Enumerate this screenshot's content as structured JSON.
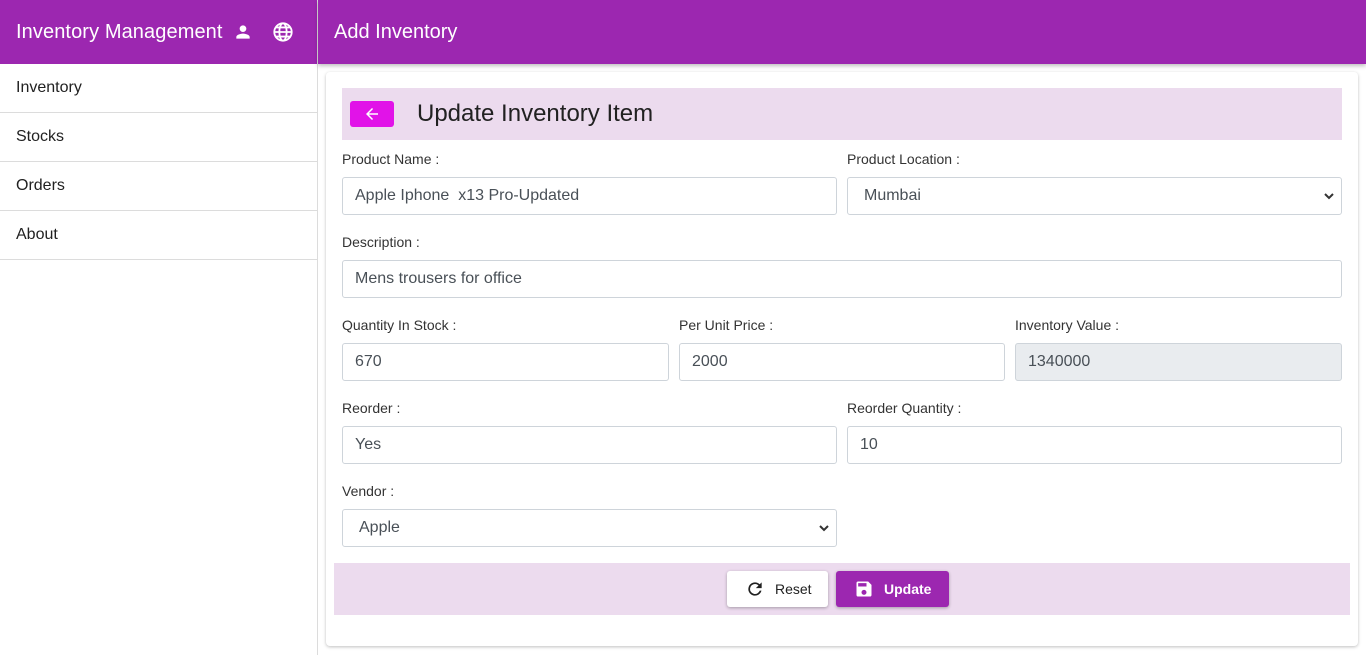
{
  "sidebar": {
    "title": "Inventory Management",
    "icons": [
      "person-icon",
      "globe-icon"
    ],
    "items": [
      {
        "label": "Inventory"
      },
      {
        "label": "Stocks"
      },
      {
        "label": "Orders"
      },
      {
        "label": "About"
      }
    ]
  },
  "topbar": {
    "title": "Add Inventory"
  },
  "form": {
    "title": "Update Inventory Item",
    "product_name": {
      "label": "Product Name :",
      "value": "Apple Iphone  x13 Pro-Updated"
    },
    "product_location": {
      "label": "Product Location :",
      "value": "Mumbai"
    },
    "description": {
      "label": "Description :",
      "value": "Mens trousers for office"
    },
    "quantity_in_stock": {
      "label": "Quantity In Stock :",
      "value": "670"
    },
    "per_unit_price": {
      "label": "Per Unit Price :",
      "value": "2000"
    },
    "inventory_value": {
      "label": "Inventory Value :",
      "value": "1340000"
    },
    "reorder": {
      "label": "Reorder :",
      "value": "Yes"
    },
    "reorder_quantity": {
      "label": "Reorder Quantity :",
      "value": "10"
    },
    "vendor": {
      "label": "Vendor :",
      "value": "Apple"
    }
  },
  "actions": {
    "reset_label": "Reset",
    "update_label": "Update"
  },
  "colors": {
    "primary": "#9c27b0",
    "accent": "#e113e8",
    "header_tint": "#ecdbee"
  }
}
